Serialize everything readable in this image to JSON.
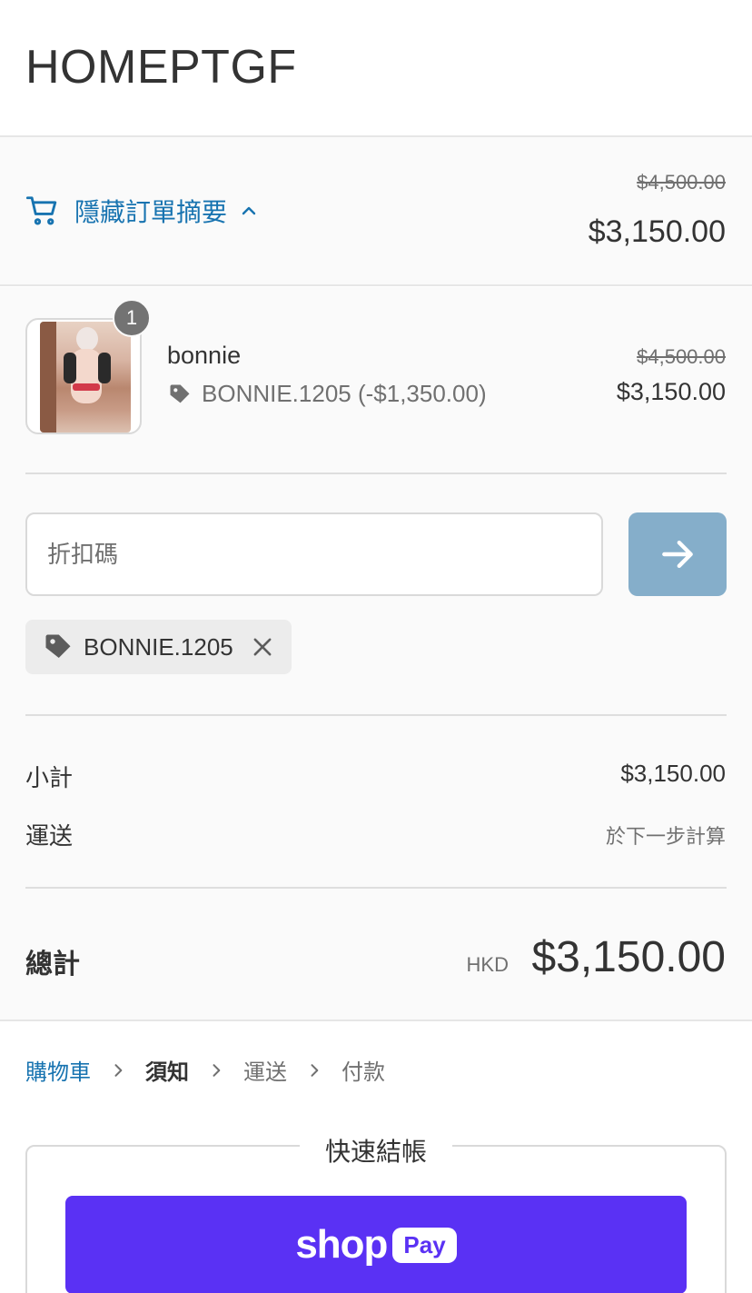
{
  "header": {
    "store_name": "HOMEPTGF"
  },
  "summary_toggle": {
    "label": "隱藏訂單摘要",
    "icon": "cart-icon",
    "chevron": "chevron-up-icon",
    "original_total": "$4,500.00",
    "total": "$3,150.00"
  },
  "line_item": {
    "quantity": "1",
    "name": "bonnie",
    "discount": "BONNIE.1205 (-$1,350.00)",
    "original_price": "$4,500.00",
    "price": "$3,150.00"
  },
  "discount_form": {
    "placeholder": "折扣碼",
    "applied_code": "BONNIE.1205"
  },
  "totals": {
    "subtotal_label": "小計",
    "subtotal_value": "$3,150.00",
    "shipping_label": "運送",
    "shipping_value": "於下一步計算",
    "total_label": "總計",
    "currency": "HKD",
    "total_value": "$3,150.00"
  },
  "breadcrumb": {
    "cart": "購物車",
    "info": "須知",
    "shipping": "運送",
    "payment": "付款"
  },
  "express_checkout": {
    "title": "快速結帳",
    "shop_text": "shop",
    "pay_text": "Pay"
  },
  "colors": {
    "link": "#1773b0",
    "apply_button": "#85aeca",
    "shop_pay": "#5a31f4"
  }
}
